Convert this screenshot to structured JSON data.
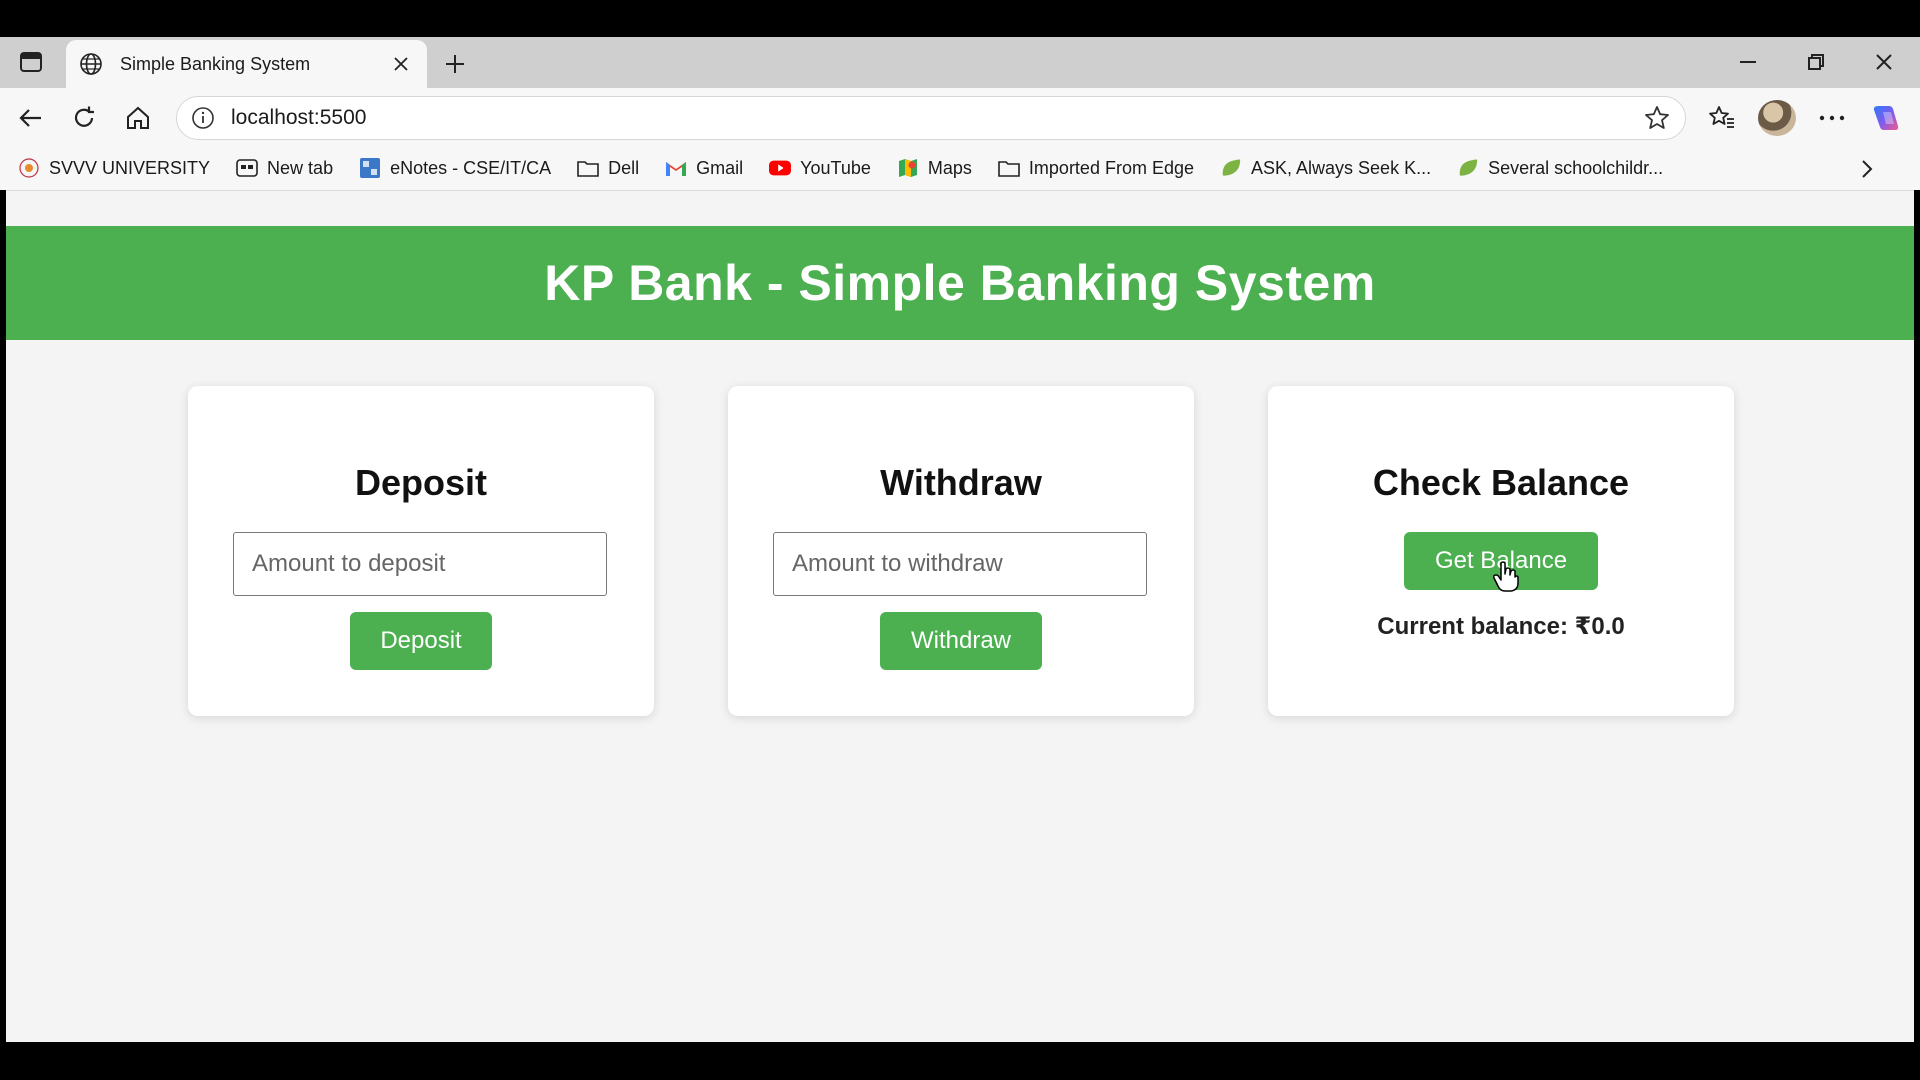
{
  "browser": {
    "tab_title": "Simple Banking System",
    "url": "localhost:5500",
    "bookmarks": [
      {
        "label": "SVVV UNIVERSITY",
        "icon": "university-icon"
      },
      {
        "label": "New tab",
        "icon": "newtab-icon"
      },
      {
        "label": "eNotes - CSE/IT/CA",
        "icon": "enotes-icon"
      },
      {
        "label": "Dell",
        "icon": "folder-icon"
      },
      {
        "label": "Gmail",
        "icon": "gmail-icon"
      },
      {
        "label": "YouTube",
        "icon": "youtube-icon"
      },
      {
        "label": "Maps",
        "icon": "maps-icon"
      },
      {
        "label": "Imported From Edge",
        "icon": "folder-icon"
      },
      {
        "label": "ASK, Always Seek K...",
        "icon": "leaf-icon"
      },
      {
        "label": "Several schoolchildr...",
        "icon": "leaf-icon"
      }
    ]
  },
  "page": {
    "header_title": "KP Bank - Simple Banking System",
    "deposit": {
      "heading": "Deposit",
      "placeholder": "Amount to deposit",
      "button_label": "Deposit"
    },
    "withdraw": {
      "heading": "Withdraw",
      "placeholder": "Amount to withdraw",
      "button_label": "Withdraw"
    },
    "balance": {
      "heading": "Check Balance",
      "button_label": "Get Balance",
      "current_balance_text": "Current balance: ₹0.0"
    }
  },
  "colors": {
    "brand_green": "#4caf50",
    "page_bg": "#f4f4f4"
  }
}
